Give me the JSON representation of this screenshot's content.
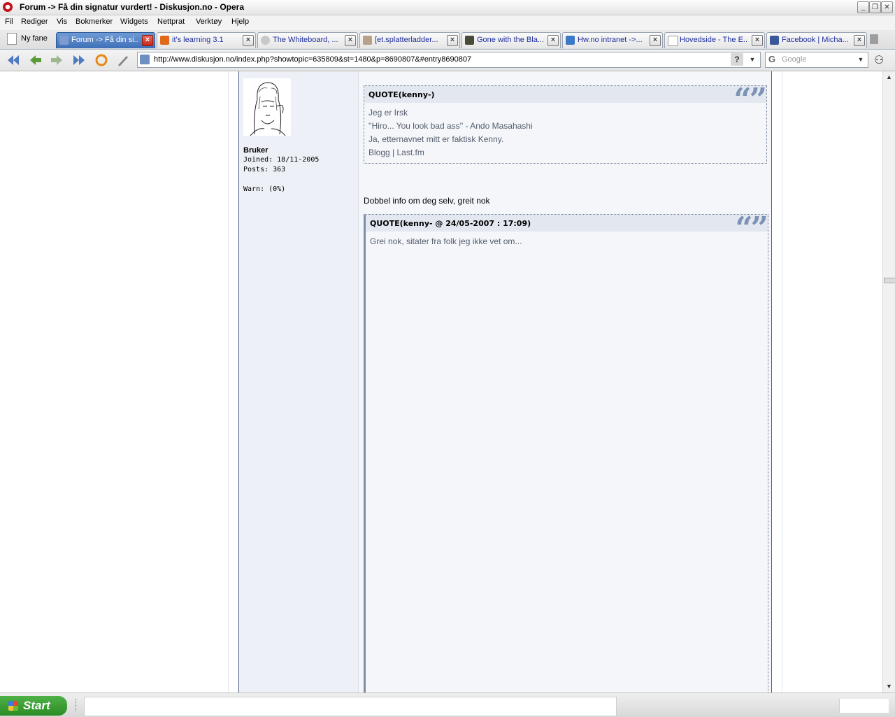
{
  "window": {
    "title": "Forum -> Få din signatur vurdert! - Diskusjon.no - Opera"
  },
  "menu": [
    "Fil",
    "Rediger",
    "Vis",
    "Bokmerker",
    "Widgets",
    "Nettprat",
    "Verktøy",
    "Hjelp"
  ],
  "tabs": {
    "new_tab_label": "Ny fane",
    "items": [
      {
        "label": "Forum -> Få din si...",
        "favicon": "diskusjon-icon",
        "active": true
      },
      {
        "label": "it's learning 3.1",
        "favicon": "itslearning-icon",
        "active": false
      },
      {
        "label": "The Whiteboard, ...",
        "favicon": "whiteboard-icon",
        "active": false
      },
      {
        "label": "[et.splatterladder...",
        "favicon": "splatterladder-icon",
        "active": false
      },
      {
        "label": "Gone with the Bla...",
        "favicon": "image-icon",
        "active": false
      },
      {
        "label": "Hw.no intranet ->...",
        "favicon": "hw-icon",
        "active": false
      },
      {
        "label": "Hovedside - The E...",
        "favicon": "page-icon",
        "active": false
      },
      {
        "label": "Facebook | Micha...",
        "favicon": "facebook-icon",
        "active": false
      }
    ]
  },
  "address": {
    "url": "http://www.diskusjon.no/index.php?showtopic=635809&st=1480&p=8690807&#entry8690807",
    "help": "?"
  },
  "search": {
    "engine_letter": "G",
    "placeholder": "Google"
  },
  "user": {
    "group": "Bruker",
    "joined": "Joined: 18/11-2005",
    "posts": "Posts: 363",
    "warn": "Warn: (0%)"
  },
  "post": {
    "quote1": {
      "title": "QUOTE(kenny-)",
      "lines": [
        "Jeg er Irsk",
        "''Hiro... You look bad ass'' - Ando Masahashi",
        "Ja, etternavnet mitt er faktisk Kenny.",
        "Blogg | Last.fm"
      ]
    },
    "reply": "Dobbel info om deg selv, greit nok",
    "quote2": {
      "title": "QUOTE(kenny- @ 24/05-2007 : 17:09)",
      "lines": [
        "Grei nok, sitater fra folk jeg ikke vet om..."
      ]
    },
    "quote_mark": "“”"
  },
  "taskbar": {
    "start_label": "Start"
  },
  "colors": {
    "accent": "#3f6fb7",
    "quote_bg": "#f4f6fa",
    "quote_head": "#e3e8f0",
    "border": "#4b5f80"
  }
}
